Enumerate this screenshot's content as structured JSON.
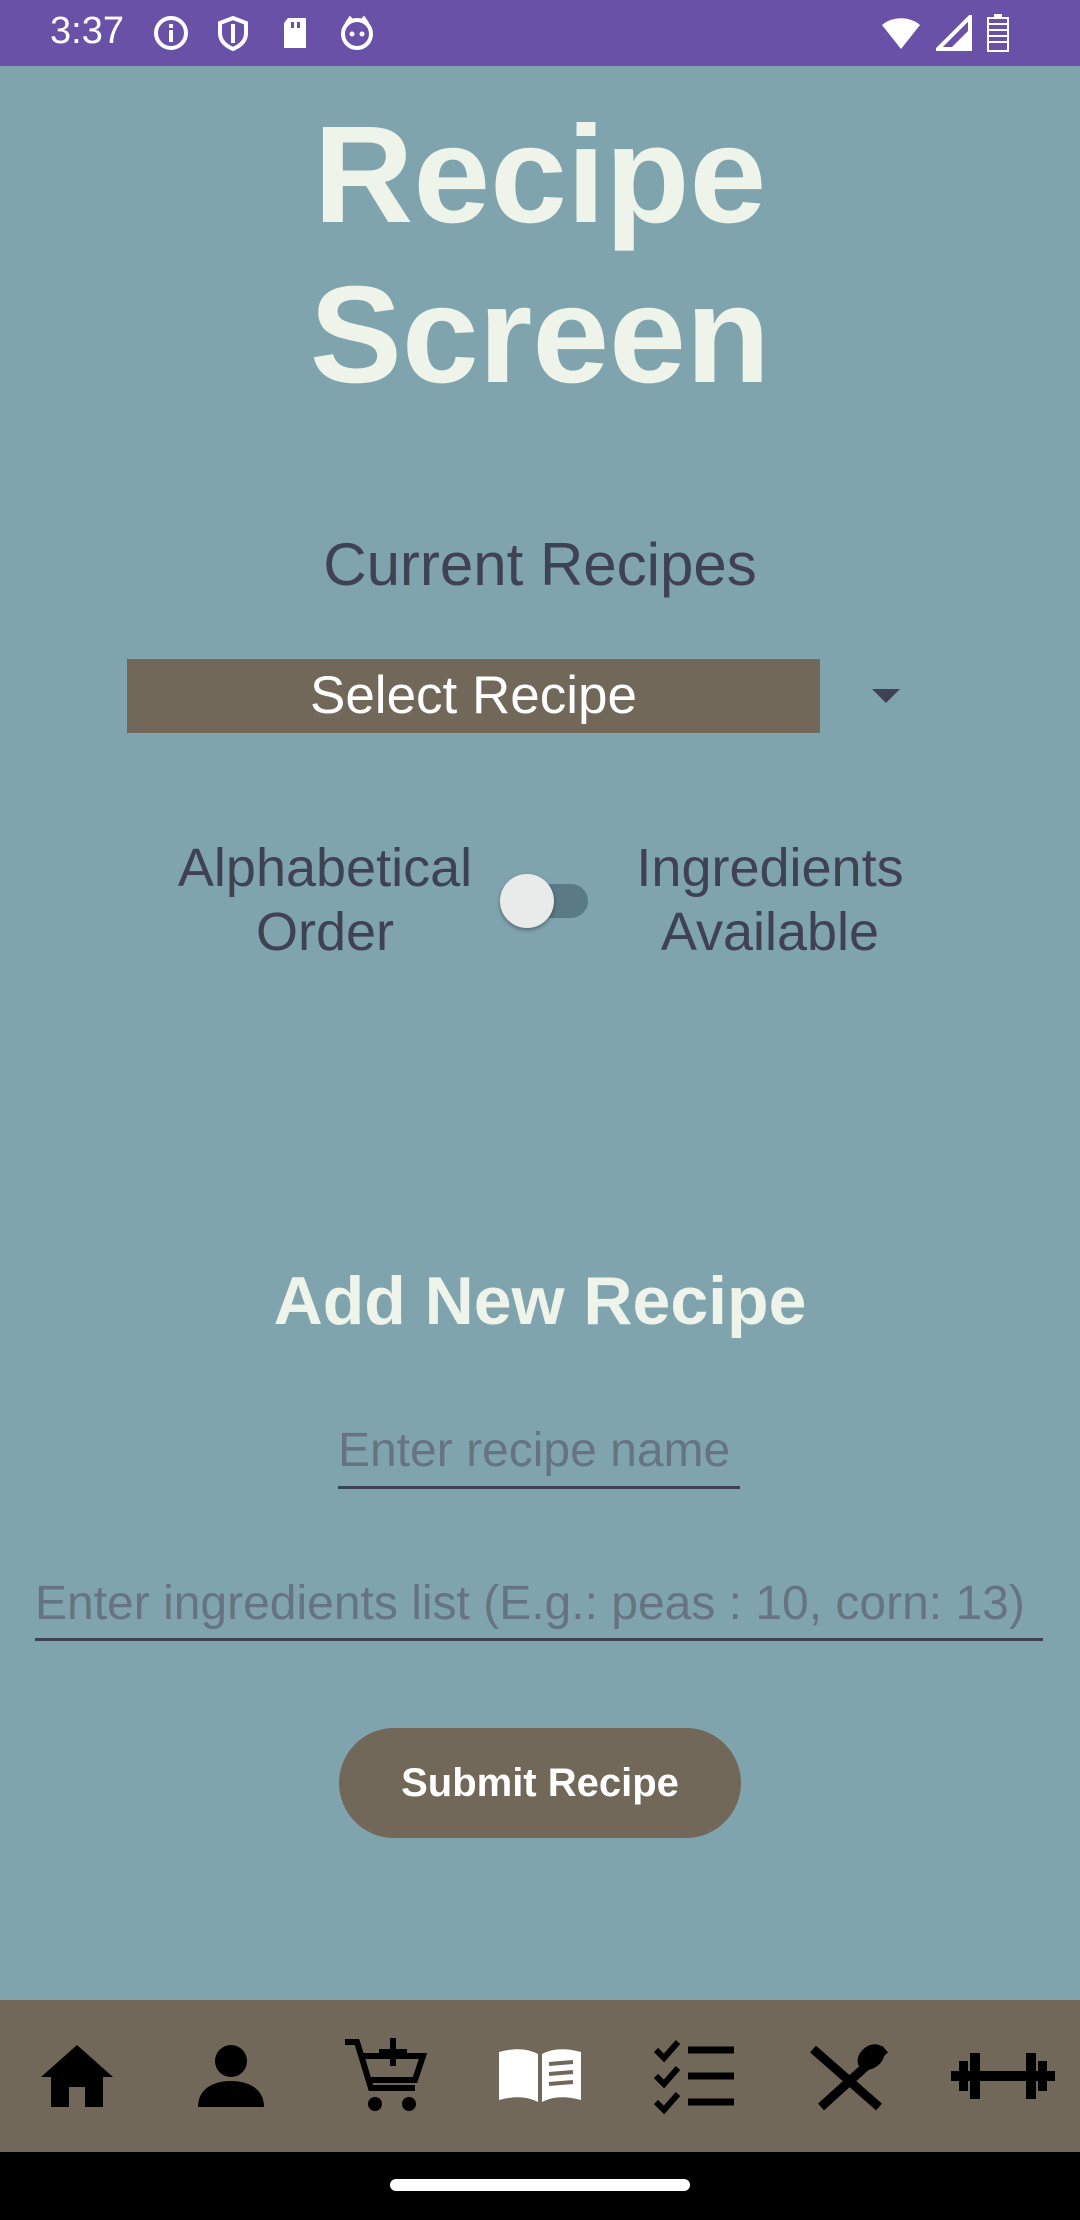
{
  "status_bar": {
    "time": "3:37",
    "icons": [
      "info-icon",
      "shield-icon",
      "sd-card-icon",
      "cat-icon"
    ],
    "right_icons": [
      "wifi-icon",
      "signal-icon",
      "battery-icon"
    ]
  },
  "title": {
    "line1": "Recipe",
    "line2": "Screen"
  },
  "current_recipes_label": "Current Recipes",
  "select": {
    "value": "Select Recipe"
  },
  "toggle": {
    "left_line1": "Alphabetical",
    "left_line2": "Order",
    "right_line1": "Ingredients",
    "right_line2": "Available",
    "checked": false
  },
  "add_new_title": "Add New Recipe",
  "inputs": {
    "recipe_name_placeholder": "Enter recipe name",
    "ingredients_placeholder": "Enter ingredients list (E.g.: peas : 10, corn: 13)"
  },
  "submit_label": "Submit Recipe",
  "nav_icons": [
    "home-icon",
    "person-icon",
    "cart-add-icon",
    "book-icon",
    "checklist-icon",
    "utensils-icon",
    "dumbbell-icon"
  ],
  "colors": {
    "background": "#80a4ae",
    "status_bar": "#6a51a8",
    "accent_brown": "#726859",
    "title_text": "#eef4ea",
    "label_text": "#3f4252"
  }
}
